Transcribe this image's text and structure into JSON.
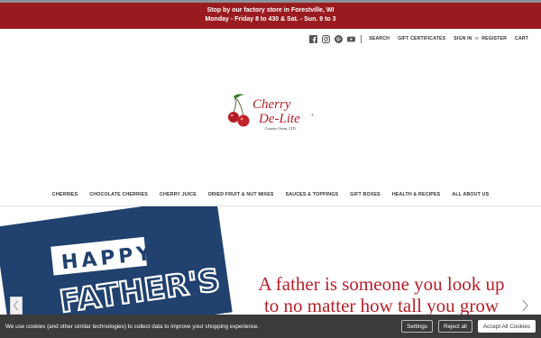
{
  "announcement": {
    "line1": "Stop by our factory store in Forestville, WI",
    "line2": "Monday - Friday 8 to 430 & Sat. - Sun. 9 to 3"
  },
  "social": [
    "facebook-icon",
    "instagram-icon",
    "pinterest-icon",
    "youtube-icon"
  ],
  "utility": {
    "search": "SEARCH",
    "gift_certificates": "GIFT CERTIFICATES",
    "sign_in": "SIGN IN",
    "or": "or",
    "register": "REGISTER",
    "cart": "CART"
  },
  "logo": {
    "line1": "Cherry",
    "line2": "De-Lite",
    "registered": "®",
    "tagline": "Country Ovens, LTD."
  },
  "nav": [
    "CHERRIES",
    "CHOCOLATE CHERRIES",
    "CHERRY JUICE",
    "DRIED FRUIT & NUT MIXES",
    "SAUCES & TOPPINGS",
    "GIFT BOXES",
    "HEALTH & RECIPES",
    "ALL ABOUT US"
  ],
  "hero": {
    "card_line1": "HAPPY",
    "card_line2": "FATHER'S",
    "quote_line1": "A father is someone you look up",
    "quote_line2": "to no matter how tall you grow"
  },
  "cookie": {
    "text": "We use cookies (and other similar technologies) to collect data to improve your shopping experience.",
    "settings": "Settings",
    "reject": "Reject all",
    "accept": "Accept All Cookies"
  },
  "colors": {
    "announcement_bg": "#9a1b1f",
    "quote": "#b5202a",
    "card_bg": "#21416e",
    "cookie_bg": "#3b3b3b"
  }
}
